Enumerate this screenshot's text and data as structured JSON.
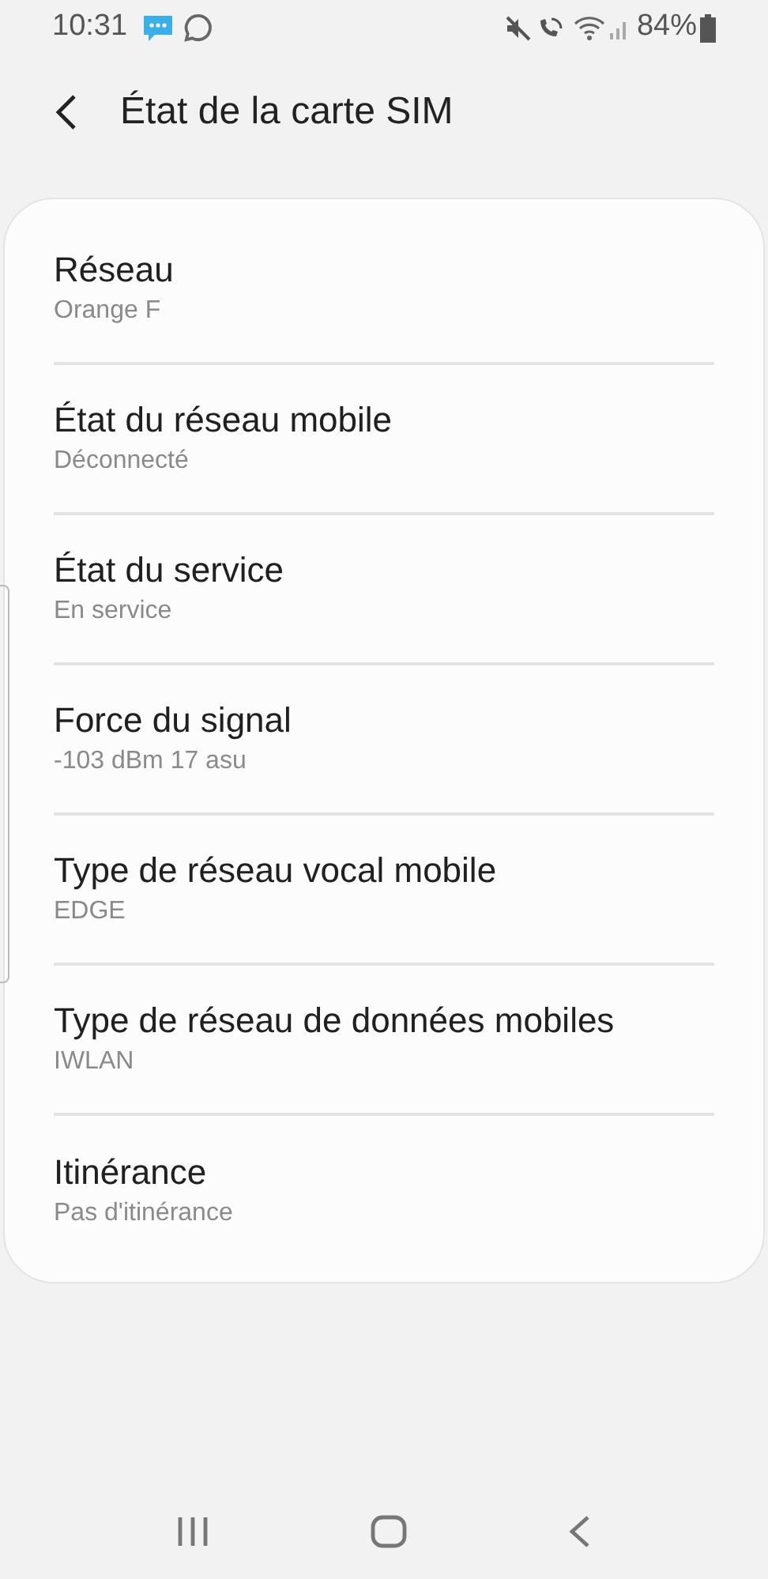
{
  "status_bar": {
    "time": "10:31",
    "battery": "84%"
  },
  "header": {
    "title": "État de la carte SIM"
  },
  "items": [
    {
      "title": "Réseau",
      "value": "Orange F"
    },
    {
      "title": "État du réseau mobile",
      "value": "Déconnecté"
    },
    {
      "title": "État du service",
      "value": "En service"
    },
    {
      "title": "Force du signal",
      "value": "-103 dBm 17 asu"
    },
    {
      "title": "Type de réseau vocal mobile",
      "value": "EDGE"
    },
    {
      "title": "Type de réseau de données mobiles",
      "value": "IWLAN"
    },
    {
      "title": "Itinérance",
      "value": "Pas d'itinérance"
    }
  ]
}
